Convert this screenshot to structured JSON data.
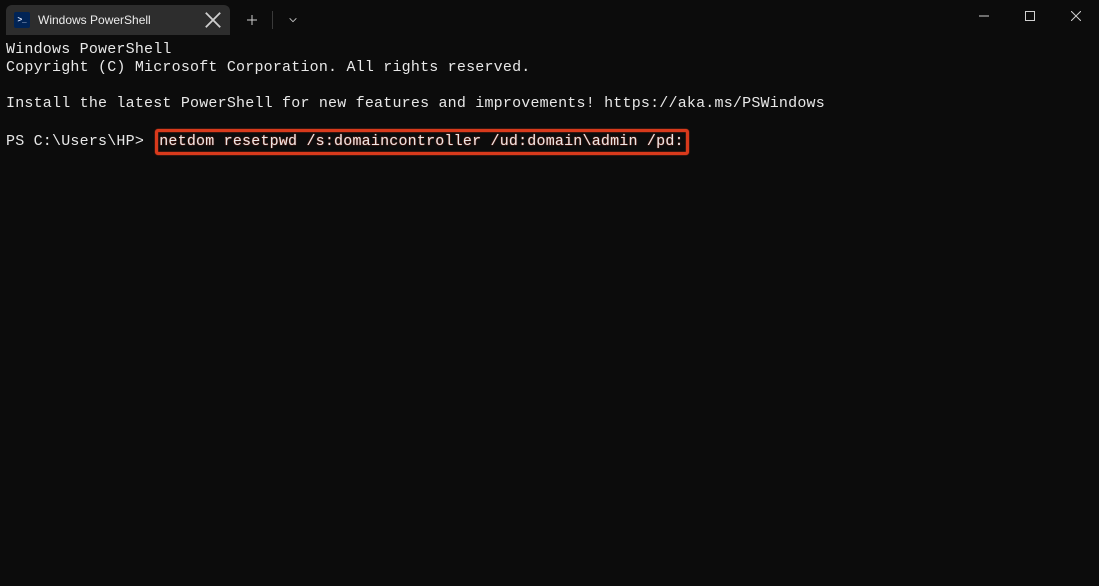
{
  "window": {
    "tab_title": "Windows PowerShell"
  },
  "terminal": {
    "line1": "Windows PowerShell",
    "line2": "Copyright (C) Microsoft Corporation. All rights reserved.",
    "blank1": "",
    "line3": "Install the latest PowerShell for new features and improvements! https://aka.ms/PSWindows",
    "blank2": "",
    "prompt": "PS C:\\Users\\HP>",
    "command": "netdom resetpwd /s:domaincontroller /ud:domain\\admin /pd:"
  }
}
